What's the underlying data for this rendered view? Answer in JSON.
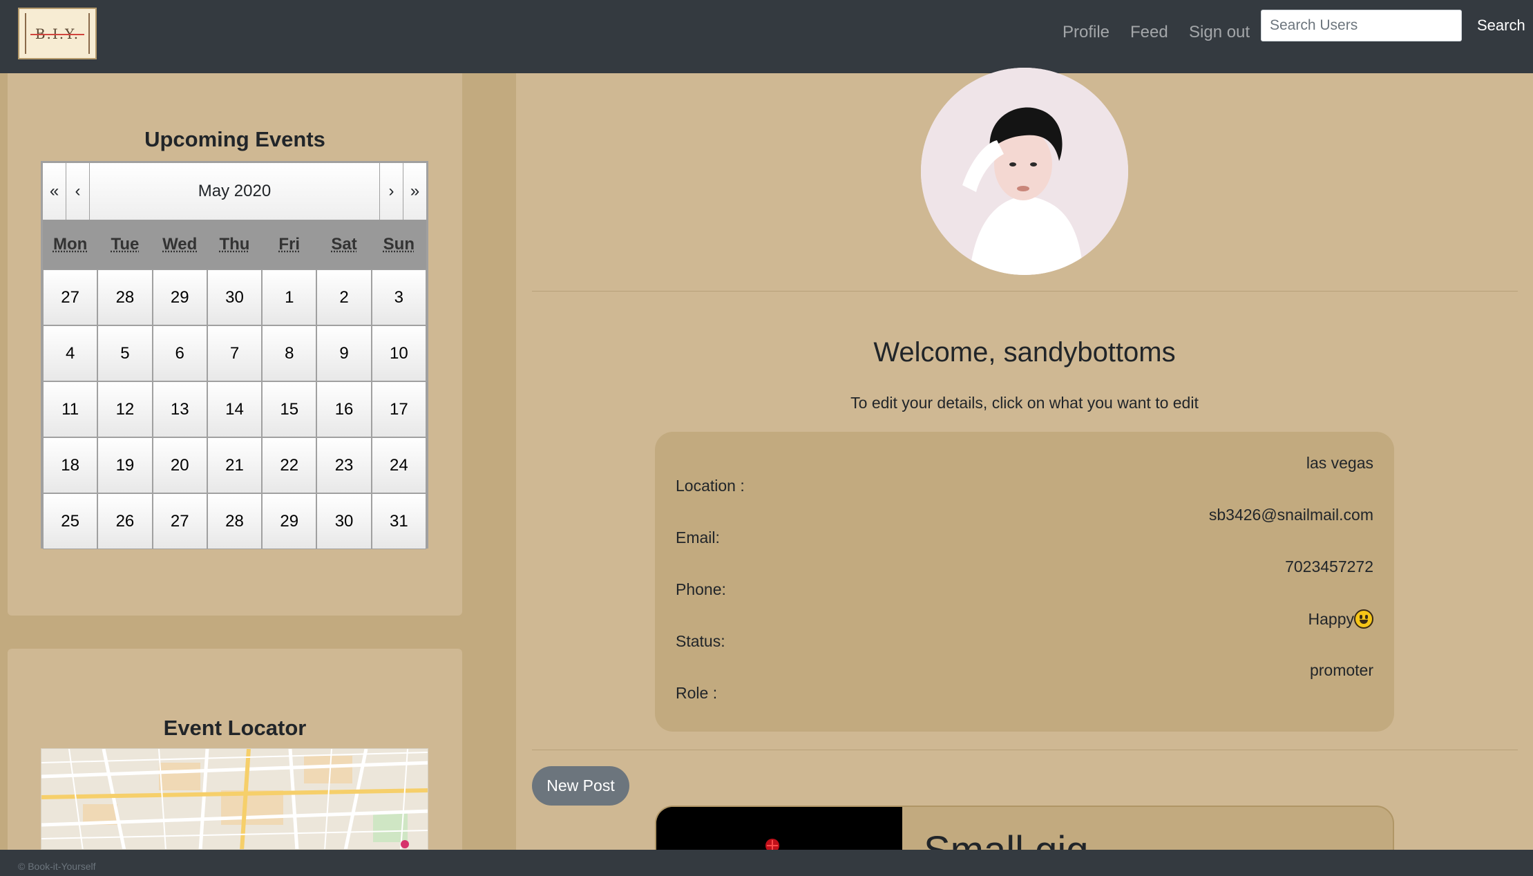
{
  "logo": {
    "text": "B.I.Y."
  },
  "nav": {
    "profile": "Profile",
    "feed": "Feed",
    "signout": "Sign out",
    "search_placeholder": "Search Users",
    "search_button": "Search"
  },
  "events": {
    "title": "Upcoming Events",
    "calendar": {
      "month_label": "May 2020",
      "prev_year": "«",
      "prev_month": "‹",
      "next_month": "›",
      "next_year": "»",
      "weekdays": [
        "Mon",
        "Tue",
        "Wed",
        "Thu",
        "Fri",
        "Sat",
        "Sun"
      ],
      "days": [
        "27",
        "28",
        "29",
        "30",
        "1",
        "2",
        "3",
        "4",
        "5",
        "6",
        "7",
        "8",
        "9",
        "10",
        "11",
        "12",
        "13",
        "14",
        "15",
        "16",
        "17",
        "18",
        "19",
        "20",
        "21",
        "22",
        "23",
        "24",
        "25",
        "26",
        "27",
        "28",
        "29",
        "30",
        "31"
      ]
    }
  },
  "locator": {
    "title": "Event Locator"
  },
  "profile": {
    "welcome": "Welcome, sandybottoms",
    "edit_hint": "To edit your details, click on what you want to edit",
    "details": [
      {
        "label": "Location :",
        "value": "las vegas"
      },
      {
        "label": "Email:",
        "value": "sb3426@snailmail.com"
      },
      {
        "label": "Phone:",
        "value": "7023457272"
      },
      {
        "label": "Status:",
        "value": "Happy"
      },
      {
        "label": "Role :",
        "value": "promoter"
      }
    ]
  },
  "posts": {
    "new_post_button": "New Post",
    "first_title": "Small gig"
  },
  "footer": {
    "text": "© Book-it-Yourself"
  }
}
